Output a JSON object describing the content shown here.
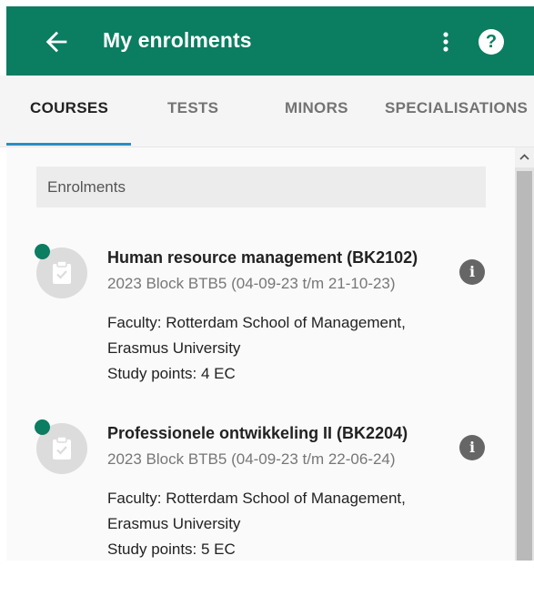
{
  "header": {
    "title": "My enrolments",
    "back_icon": "arrow-left-icon",
    "more_icon": "more-vertical-icon",
    "help_label": "?"
  },
  "tabs": [
    {
      "label": "COURSES",
      "active": true
    },
    {
      "label": "TESTS",
      "active": false
    },
    {
      "label": "MINORS",
      "active": false
    },
    {
      "label": "SPECIALISATIONS",
      "active": false
    }
  ],
  "section": {
    "title": "Enrolments"
  },
  "enrolments": [
    {
      "title": "Human resource management (BK2102)",
      "period": "2023 Block BTB5 (04-09-23 t/m 21-10-23)",
      "faculty_line1": "Faculty: Rotterdam School of Management,",
      "faculty_line2": "Erasmus University",
      "study_points": "Study points: 4 EC",
      "info_label": "i",
      "icon": "clipboard-check-icon",
      "status_color": "#0b7d61"
    },
    {
      "title": "Professionele ontwikkeling II (BK2204)",
      "period": "2023 Block BTB5 (04-09-23 t/m 22-06-24)",
      "faculty_line1": "Faculty: Rotterdam School of Management,",
      "faculty_line2": "Erasmus University",
      "study_points": "Study points: 5 EC",
      "info_label": "i",
      "icon": "clipboard-check-icon",
      "status_color": "#0b7d61"
    }
  ],
  "colors": {
    "brand": "#0b7d61",
    "tab_indicator": "#2b8dc4"
  }
}
